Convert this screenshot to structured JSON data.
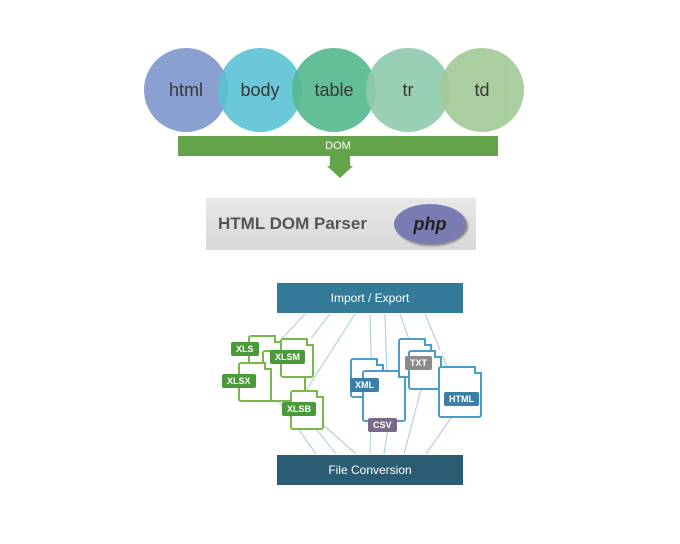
{
  "dom_chain": {
    "nodes": [
      "html",
      "body",
      "table",
      "tr",
      "td"
    ],
    "label": "DOM"
  },
  "parser": {
    "title": "HTML DOM Parser",
    "logo_text": "php"
  },
  "workflow": {
    "top_bar": "Import / Export",
    "bottom_bar": "File Conversion",
    "file_tags": {
      "xls": "XLS",
      "xlsx": "XLSX",
      "xlsm": "XLSM",
      "xlsb": "XLSB",
      "xml": "XML",
      "txt": "TXT",
      "html": "HTML",
      "csv": "CSV"
    }
  }
}
